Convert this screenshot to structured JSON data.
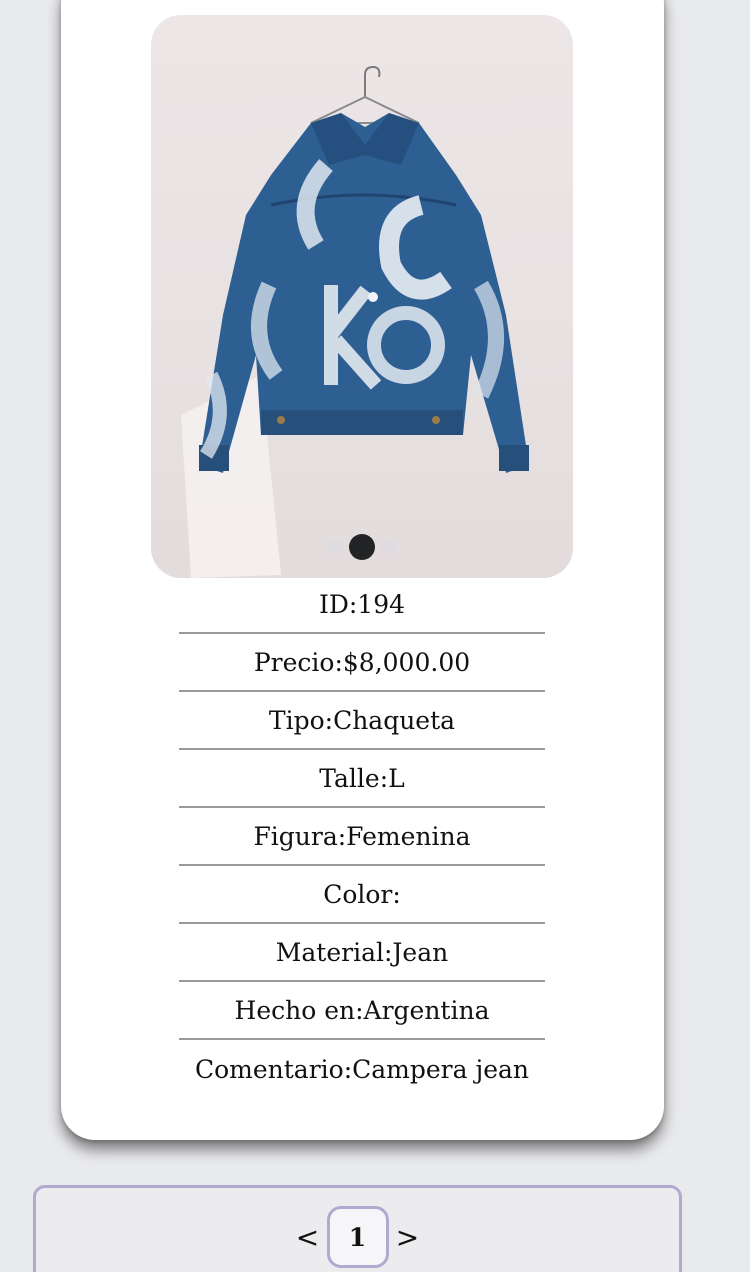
{
  "product": {
    "image_alt": "Campera jean",
    "carousel": {
      "total": 3,
      "active_index": 1
    },
    "details": [
      {
        "key": "id",
        "text": "ID:194"
      },
      {
        "key": "price",
        "text": "Precio:$8,000.00"
      },
      {
        "key": "type",
        "text": "Tipo:Chaqueta"
      },
      {
        "key": "size",
        "text": "Talle:L"
      },
      {
        "key": "figure",
        "text": "Figura:Femenina"
      },
      {
        "key": "color",
        "text": "Color:"
      },
      {
        "key": "material",
        "text": "Material:Jean"
      },
      {
        "key": "made_in",
        "text": "Hecho en:Argentina"
      },
      {
        "key": "comment",
        "text": "Comentario:Campera jean"
      }
    ]
  },
  "pagination": {
    "prev_label": "<",
    "current_page": "1",
    "next_label": ">"
  },
  "colors": {
    "background": "#e9eaec",
    "card": "#ffffff",
    "accent_border": "#b1aad0",
    "denim": "#2e5f93"
  },
  "icons": {
    "hanger": "hanger-icon"
  }
}
